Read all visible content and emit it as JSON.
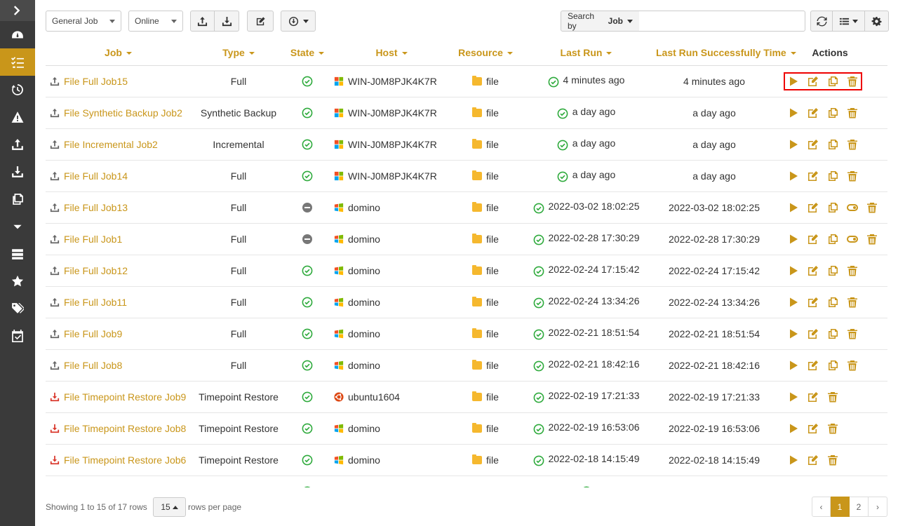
{
  "sidebar": {
    "items": [
      {
        "name": "expand-icon"
      },
      {
        "name": "dashboard-icon"
      },
      {
        "name": "jobs-list-icon",
        "active": true
      },
      {
        "name": "history-icon"
      },
      {
        "name": "alert-icon"
      },
      {
        "name": "upload-icon"
      },
      {
        "name": "download-icon"
      },
      {
        "name": "copy-icon"
      },
      {
        "name": "caret-down-icon"
      },
      {
        "name": "server-icon"
      },
      {
        "name": "star-icon"
      },
      {
        "name": "tags-icon"
      },
      {
        "name": "calendar-check-icon"
      }
    ]
  },
  "toolbar": {
    "job_type_filter": "General Job",
    "status_filter": "Online",
    "search_by_prefix": "Search by",
    "search_by_field": "Job",
    "search_value": ""
  },
  "table": {
    "columns": {
      "job": "Job",
      "type": "Type",
      "state": "State",
      "host": "Host",
      "resource": "Resource",
      "last_run": "Last Run",
      "last_success": "Last Run Successfully Time",
      "actions": "Actions"
    },
    "rows": [
      {
        "job": "File Full Job15",
        "kind": "backup",
        "type": "Full",
        "state": "ok",
        "host": "WIN-J0M8PJK4K7R",
        "os": "windows",
        "resource": "file",
        "last_run": "4 minutes ago",
        "last_success": "4 minutes ago",
        "actions": [
          "run",
          "edit",
          "copy",
          "delete"
        ],
        "highlight": true
      },
      {
        "job": "File Synthetic Backup Job2",
        "kind": "backup",
        "type": "Synthetic Backup",
        "state": "ok",
        "host": "WIN-J0M8PJK4K7R",
        "os": "windows",
        "resource": "file",
        "last_run": "a day ago",
        "last_success": "a day ago",
        "actions": [
          "run",
          "edit",
          "copy",
          "delete"
        ]
      },
      {
        "job": "File Incremental Job2",
        "kind": "backup",
        "type": "Incremental",
        "state": "ok",
        "host": "WIN-J0M8PJK4K7R",
        "os": "windows",
        "resource": "file",
        "last_run": "a day ago",
        "last_success": "a day ago",
        "actions": [
          "run",
          "edit",
          "copy",
          "delete"
        ]
      },
      {
        "job": "File Full Job14",
        "kind": "backup",
        "type": "Full",
        "state": "ok",
        "host": "WIN-J0M8PJK4K7R",
        "os": "windows",
        "resource": "file",
        "last_run": "a day ago",
        "last_success": "a day ago",
        "actions": [
          "run",
          "edit",
          "copy",
          "delete"
        ]
      },
      {
        "job": "File Full Job13",
        "kind": "backup",
        "type": "Full",
        "state": "disabled",
        "host": "domino",
        "os": "windows-old",
        "resource": "file",
        "last_run": "2022-03-02 18:02:25",
        "last_success": "2022-03-02 18:02:25",
        "actions": [
          "run",
          "edit",
          "copy",
          "toggle",
          "delete"
        ]
      },
      {
        "job": "File Full Job1",
        "kind": "backup",
        "type": "Full",
        "state": "disabled",
        "host": "domino",
        "os": "windows-old",
        "resource": "file",
        "last_run": "2022-02-28 17:30:29",
        "last_success": "2022-02-28 17:30:29",
        "actions": [
          "run",
          "edit",
          "copy",
          "toggle",
          "delete"
        ]
      },
      {
        "job": "File Full Job12",
        "kind": "backup",
        "type": "Full",
        "state": "ok",
        "host": "domino",
        "os": "windows-old",
        "resource": "file",
        "last_run": "2022-02-24 17:15:42",
        "last_success": "2022-02-24 17:15:42",
        "actions": [
          "run",
          "edit",
          "copy",
          "delete"
        ]
      },
      {
        "job": "File Full Job11",
        "kind": "backup",
        "type": "Full",
        "state": "ok",
        "host": "domino",
        "os": "windows-old",
        "resource": "file",
        "last_run": "2022-02-24 13:34:26",
        "last_success": "2022-02-24 13:34:26",
        "actions": [
          "run",
          "edit",
          "copy",
          "delete"
        ]
      },
      {
        "job": "File Full Job9",
        "kind": "backup",
        "type": "Full",
        "state": "ok",
        "host": "domino",
        "os": "windows-old",
        "resource": "file",
        "last_run": "2022-02-21 18:51:54",
        "last_success": "2022-02-21 18:51:54",
        "actions": [
          "run",
          "edit",
          "copy",
          "delete"
        ]
      },
      {
        "job": "File Full Job8",
        "kind": "backup",
        "type": "Full",
        "state": "ok",
        "host": "domino",
        "os": "windows-old",
        "resource": "file",
        "last_run": "2022-02-21 18:42:16",
        "last_success": "2022-02-21 18:42:16",
        "actions": [
          "run",
          "edit",
          "copy",
          "delete"
        ]
      },
      {
        "job": "File Timepoint Restore Job9",
        "kind": "restore",
        "type": "Timepoint Restore",
        "state": "ok",
        "host": "ubuntu1604",
        "os": "ubuntu",
        "resource": "file",
        "last_run": "2022-02-19 17:21:33",
        "last_success": "2022-02-19 17:21:33",
        "actions": [
          "run",
          "edit",
          "delete"
        ]
      },
      {
        "job": "File Timepoint Restore Job8",
        "kind": "restore",
        "type": "Timepoint Restore",
        "state": "ok",
        "host": "domino",
        "os": "windows-old",
        "resource": "file",
        "last_run": "2022-02-19 16:53:06",
        "last_success": "2022-02-19 16:53:06",
        "actions": [
          "run",
          "edit",
          "delete"
        ]
      },
      {
        "job": "File Timepoint Restore Job6",
        "kind": "restore",
        "type": "Timepoint Restore",
        "state": "ok",
        "host": "domino",
        "os": "windows-old",
        "resource": "file",
        "last_run": "2022-02-18 14:15:49",
        "last_success": "2022-02-18 14:15:49",
        "actions": [
          "run",
          "edit",
          "delete"
        ]
      },
      {
        "job": "",
        "kind": "backup",
        "type": "",
        "state": "ok",
        "host": "",
        "os": "",
        "resource": "",
        "last_run": "",
        "last_success": "",
        "actions": [],
        "partial": true
      }
    ]
  },
  "footer": {
    "showing": "Showing 1 to 15 of 17 rows",
    "per_page_value": "15",
    "per_page_label": "rows per page",
    "pages": [
      "‹",
      "1",
      "2",
      "›"
    ],
    "current_page": "1"
  },
  "colors": {
    "accent": "#c9961a",
    "ok": "#2eaa3c",
    "restore": "#d9382c",
    "highlight": "#e00000"
  }
}
